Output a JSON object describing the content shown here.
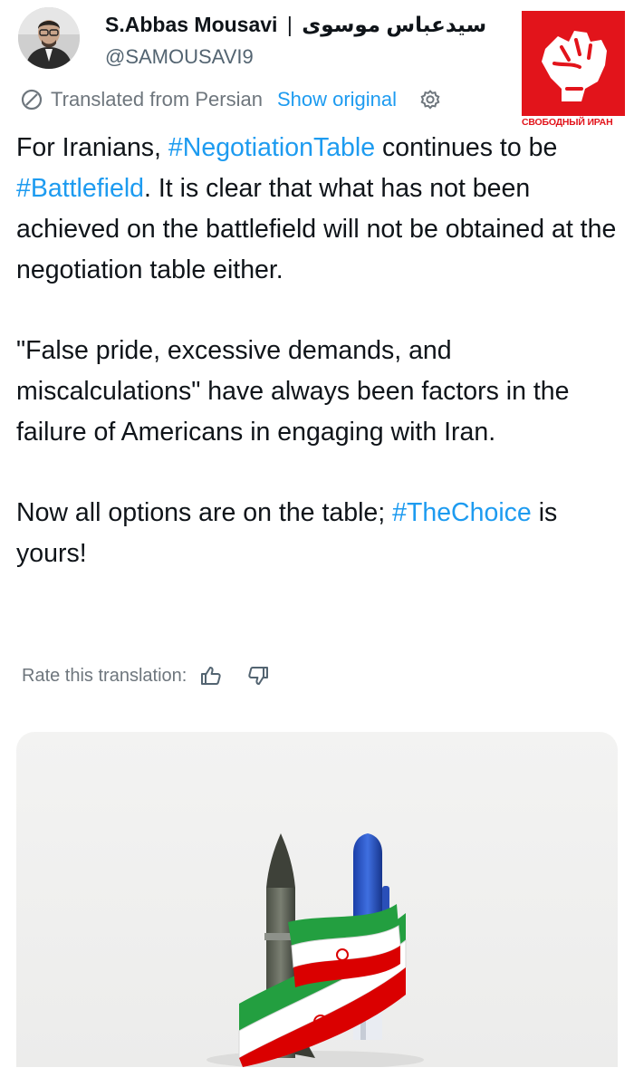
{
  "author": {
    "display_name": "S.Abbas Mousavi",
    "separator": "|",
    "display_name_fa": "سیدعباس موسوی",
    "handle": "@SAMOUSAVI9"
  },
  "logo": {
    "caption": "СВОБОДНЫЙ ИРАН",
    "color": "#e2141b"
  },
  "translation": {
    "notice": "Translated from Persian",
    "show_original": "Show original",
    "rate_label": "Rate this translation:"
  },
  "tweet": {
    "p1_before": "For Iranians, ",
    "p1_hashtag1": "#NegotiationTable",
    "p1_middle": " continues to be ",
    "p1_hashtag2": "#Battlefield",
    "p1_after": ". It is clear that what has not been achieved on the battlefield will not be obtained at the negotiation table either.",
    "p2": "\"False pride, excessive demands, and miscalculations\" have always been factors in the failure of Americans in engaging with Iran.",
    "p3_before": "Now all options are on the table; ",
    "p3_hashtag": "#TheChoice",
    "p3_after": " is yours!"
  },
  "icons": {
    "translate": "slash-circle-icon",
    "settings": "gear-icon",
    "like": "thumbs-up-icon",
    "dislike": "thumbs-down-icon"
  },
  "colors": {
    "link": "#1d9bf0",
    "muted": "#6e767d",
    "text": "#0f1419"
  }
}
